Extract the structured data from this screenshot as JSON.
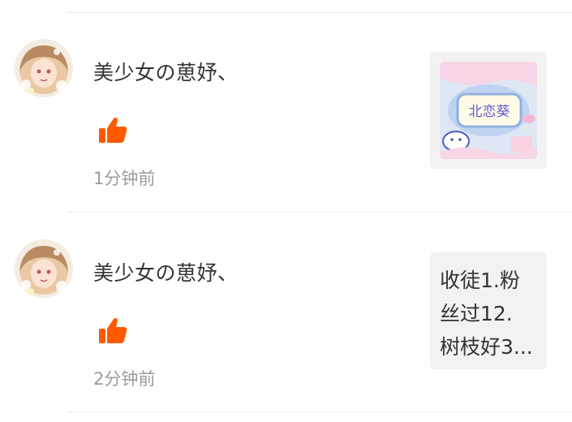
{
  "accent_color": "#ff5a00",
  "feed": [
    {
      "username": "美少女の葸妤、",
      "time": "1分钟前",
      "like_icon": "thumbs-up-icon",
      "preview_type": "image",
      "preview_image_text": "北恋葵"
    },
    {
      "username": "美少女の葸妤、",
      "time": "2分钟前",
      "like_icon": "thumbs-up-icon",
      "preview_type": "text",
      "preview_lines": [
        "收徒1.粉",
        "丝过12.",
        "树枝好3..."
      ]
    }
  ]
}
